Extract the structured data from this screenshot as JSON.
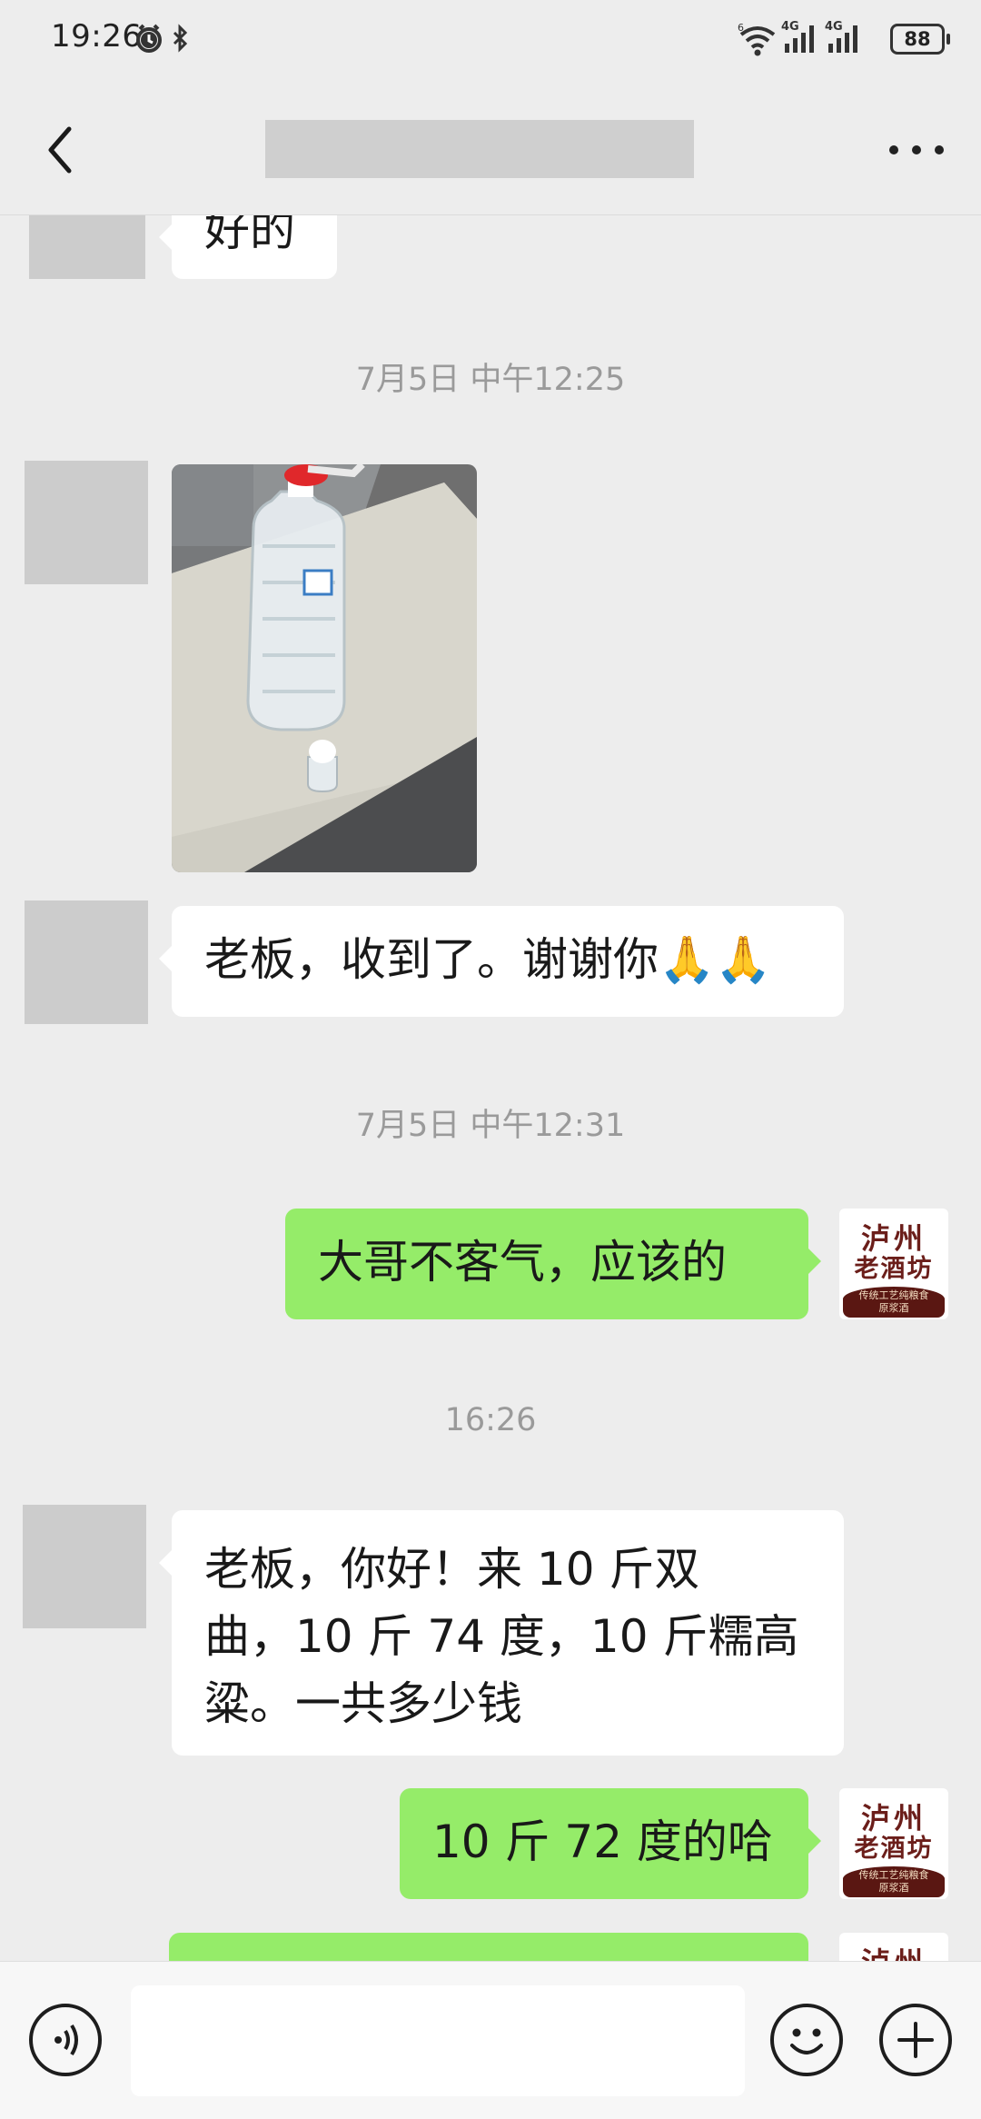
{
  "status_bar": {
    "time": "19:26",
    "signal_label_1": "4G",
    "signal_label_2": "4G",
    "battery": "88"
  },
  "header": {
    "title": ""
  },
  "messages": [
    {
      "type": "text",
      "side": "left",
      "text": "好的"
    },
    {
      "type": "timestamp",
      "text": "7月5日 中午12:25"
    },
    {
      "type": "image",
      "side": "left",
      "description": "bottle"
    },
    {
      "type": "text",
      "side": "left",
      "text": "老板，收到了。谢谢你🙏🙏"
    },
    {
      "type": "timestamp",
      "text": "7月5日 中午12:31"
    },
    {
      "type": "text",
      "side": "right",
      "text": "大哥不客气，应该的"
    },
    {
      "type": "timestamp",
      "text": "16:26"
    },
    {
      "type": "text",
      "side": "left",
      "text_lines": [
        "老板，你好！来 10 斤双",
        "曲，10 斤 74 度，10 斤糯高",
        "粱。一共多少钱"
      ]
    },
    {
      "type": "text",
      "side": "right",
      "text": "10 斤 72 度的哈"
    },
    {
      "type": "text",
      "side": "right",
      "text": ""
    }
  ],
  "self_avatar": {
    "line1": "泸州",
    "line2": "老酒坊",
    "band_line1": "传统工艺纯粮食",
    "band_line2": "原浆酒"
  },
  "input_bar": {
    "placeholder": ""
  },
  "icons": {
    "back": "back-arrow-icon",
    "more": "more-dots-icon",
    "voice": "voice-icon",
    "emoji": "emoji-icon",
    "plus": "plus-icon"
  },
  "colors": {
    "background": "#ededed",
    "sent_bubble": "#95ec69",
    "received_bubble": "#ffffff"
  }
}
